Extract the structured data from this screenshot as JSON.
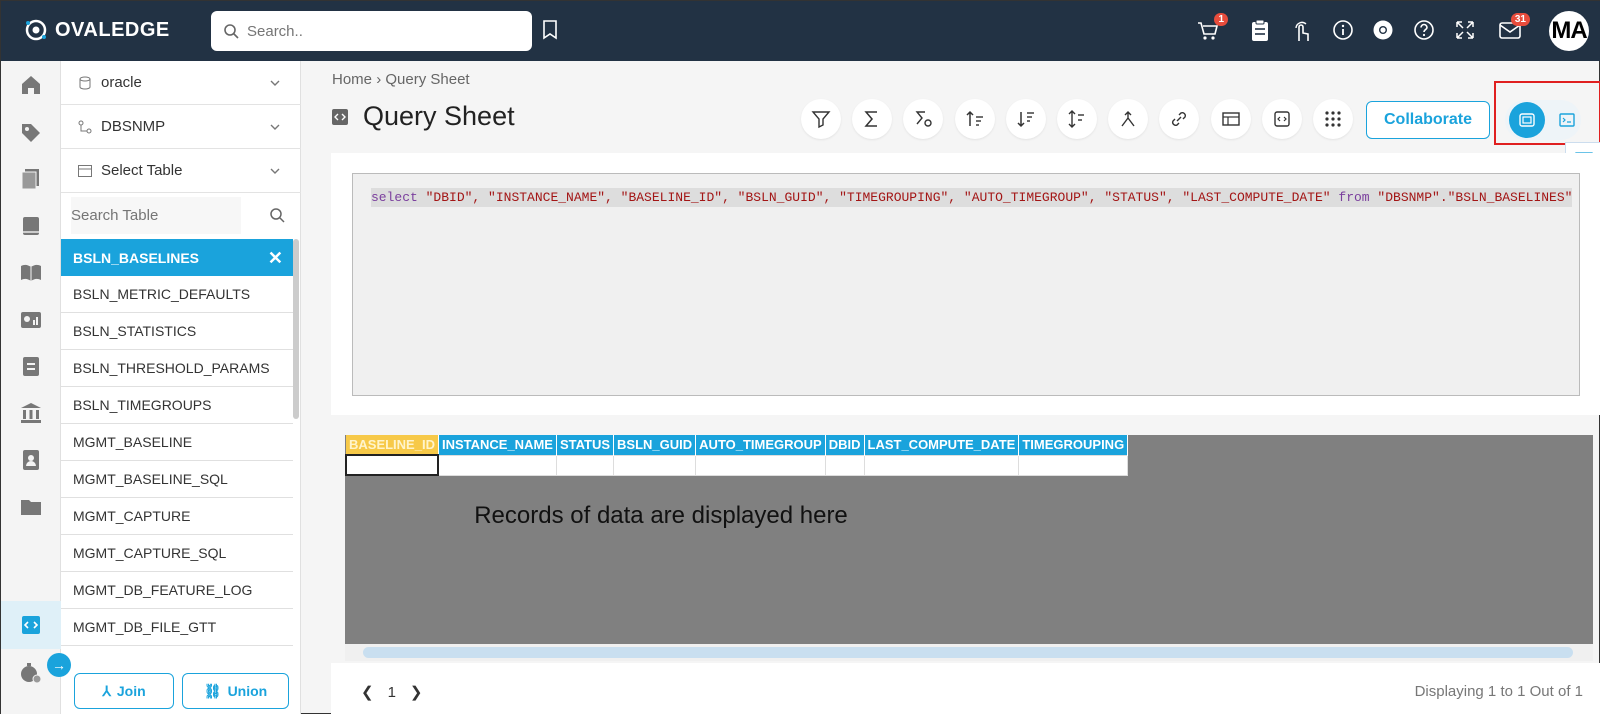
{
  "app": {
    "logo_text": "OVALEDGE",
    "avatar_initials": "MA"
  },
  "search": {
    "placeholder": "Search.."
  },
  "topbar": {
    "cart_badge": "1",
    "mail_badge": "31"
  },
  "selectors": {
    "connector": "oracle",
    "schema": "DBSNMP",
    "table": "Select Table"
  },
  "table_search": {
    "placeholder": "Search Table"
  },
  "tables": [
    "BSLN_BASELINES",
    "BSLN_METRIC_DEFAULTS",
    "BSLN_STATISTICS",
    "BSLN_THRESHOLD_PARAMS",
    "BSLN_TIMEGROUPS",
    "MGMT_BASELINE",
    "MGMT_BASELINE_SQL",
    "MGMT_CAPTURE",
    "MGMT_CAPTURE_SQL",
    "MGMT_DB_FEATURE_LOG",
    "MGMT_DB_FILE_GTT"
  ],
  "buttons": {
    "join": "Join",
    "union": "Union",
    "collaborate": "Collaborate"
  },
  "breadcrumb": {
    "home": "Home",
    "sep": "›",
    "current": "Query Sheet"
  },
  "page": {
    "title": "Query Sheet"
  },
  "query": {
    "kw_select": "select",
    "columns": "\"DBID\", \"INSTANCE_NAME\", \"BASELINE_ID\", \"BSLN_GUID\", \"TIMEGROUPING\", \"AUTO_TIMEGROUP\", \"STATUS\", \"LAST_COMPUTE_DATE\"",
    "kw_from": "from",
    "target": "\"DBSNMP\".\"BSLN_BASELINES\""
  },
  "result_columns": [
    "BASELINE_ID",
    "INSTANCE_NAME",
    "STATUS",
    "BSLN_GUID",
    "AUTO_TIMEGROUP",
    "DBID",
    "LAST_COMPUTE_DATE",
    "TIMEGROUPING"
  ],
  "overlay_note": "Records of data are displayed here",
  "pagination": {
    "page": "1",
    "status": "Displaying 1 to 1 Out of 1"
  },
  "colors": {
    "topbar": "#223244",
    "accent": "#1aa3dc",
    "highlight": "#e02020",
    "header_first": "#f7c948"
  }
}
